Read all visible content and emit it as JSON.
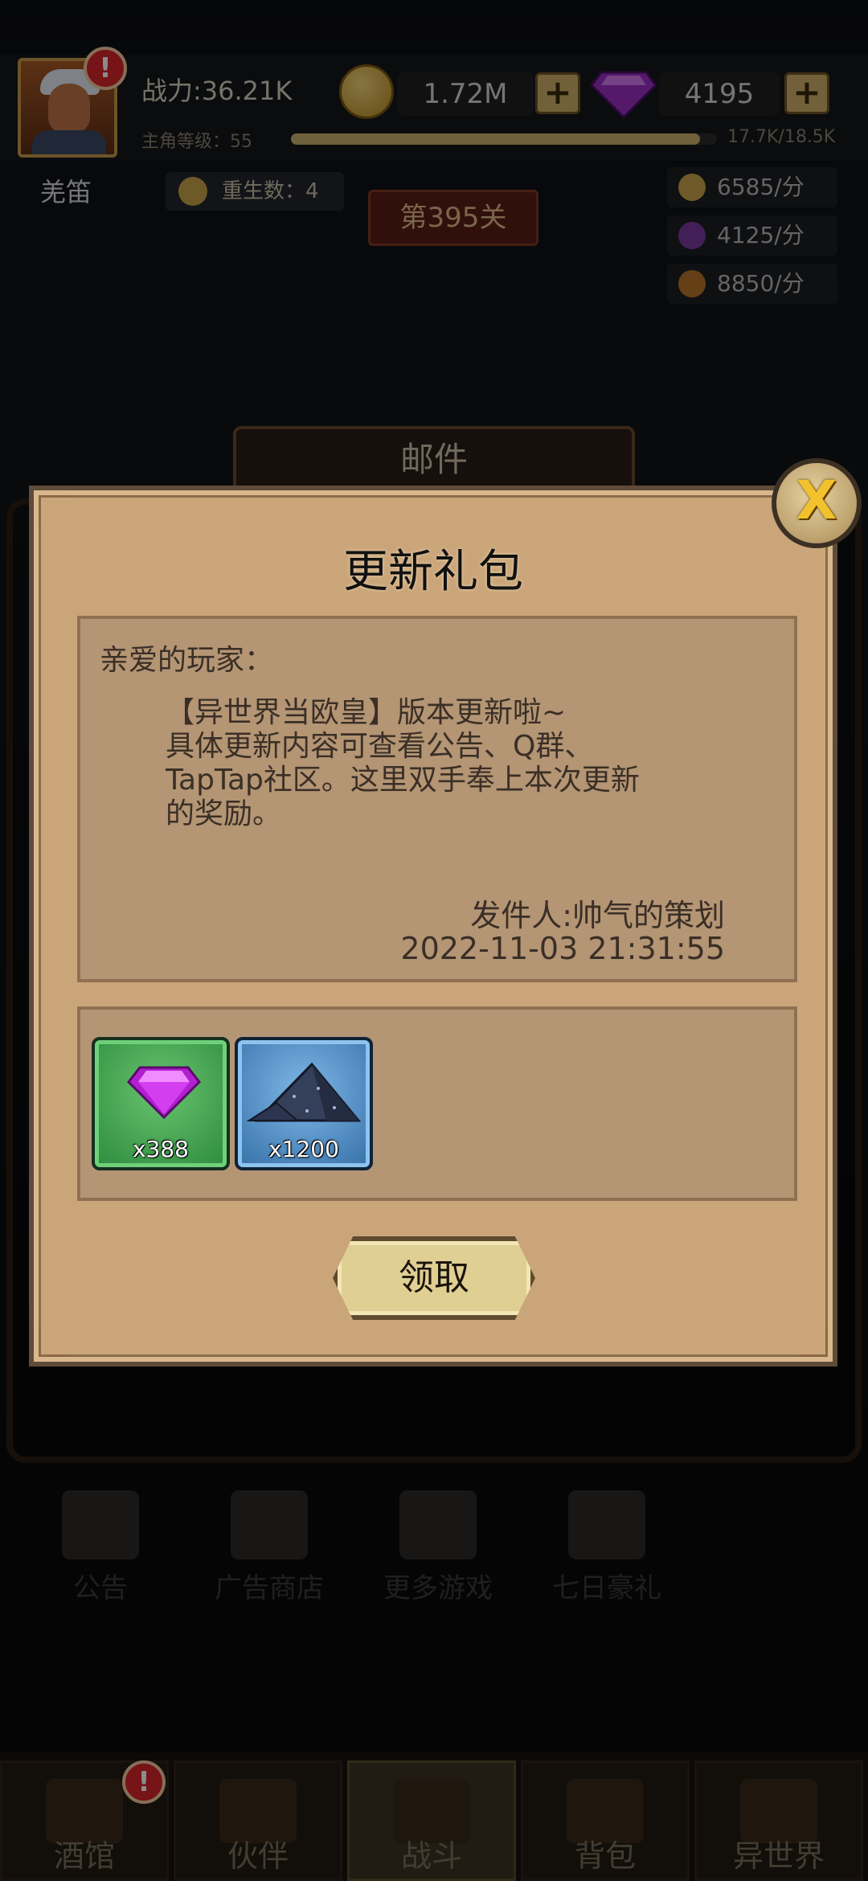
{
  "hud": {
    "power": "战力:36.21K",
    "level_label": "主角等级：55",
    "level_progress": 0.96,
    "exp_text": "17.7K/18.5K",
    "gold": "1.72M",
    "gems": "4195",
    "plus": "+",
    "player_name": "羌笛",
    "rebirth": "重生数：4",
    "stage": "第395关",
    "rates": [
      "6585/分",
      "4125/分",
      "8850/分"
    ],
    "alert": "!"
  },
  "mail_header": "邮件",
  "dialog": {
    "title": "更新礼包",
    "close": "X",
    "greeting": "亲爱的玩家：",
    "body": "【异世界当欧皇】版本更新啦~\n具体更新内容可查看公告、Q群、\nTapTap社区。这里双手奉上本次更新\n的奖励。",
    "sender": "发件人:帅气的策划",
    "date": "2022-11-03 21:31:55",
    "rewards": [
      {
        "icon": "purple-gem-icon",
        "qty": "x388"
      },
      {
        "icon": "ore-pile-icon",
        "qty": "x1200"
      }
    ],
    "claim": "领取"
  },
  "shortcuts": [
    "公告",
    "广告商店",
    "更多游戏",
    "七日豪礼"
  ],
  "nav": [
    "酒馆",
    "伙伴",
    "战斗",
    "背包",
    "异世界"
  ],
  "colors": {
    "panel": "#cba57a",
    "box": "#b49574",
    "accent": "#f2c22c"
  }
}
